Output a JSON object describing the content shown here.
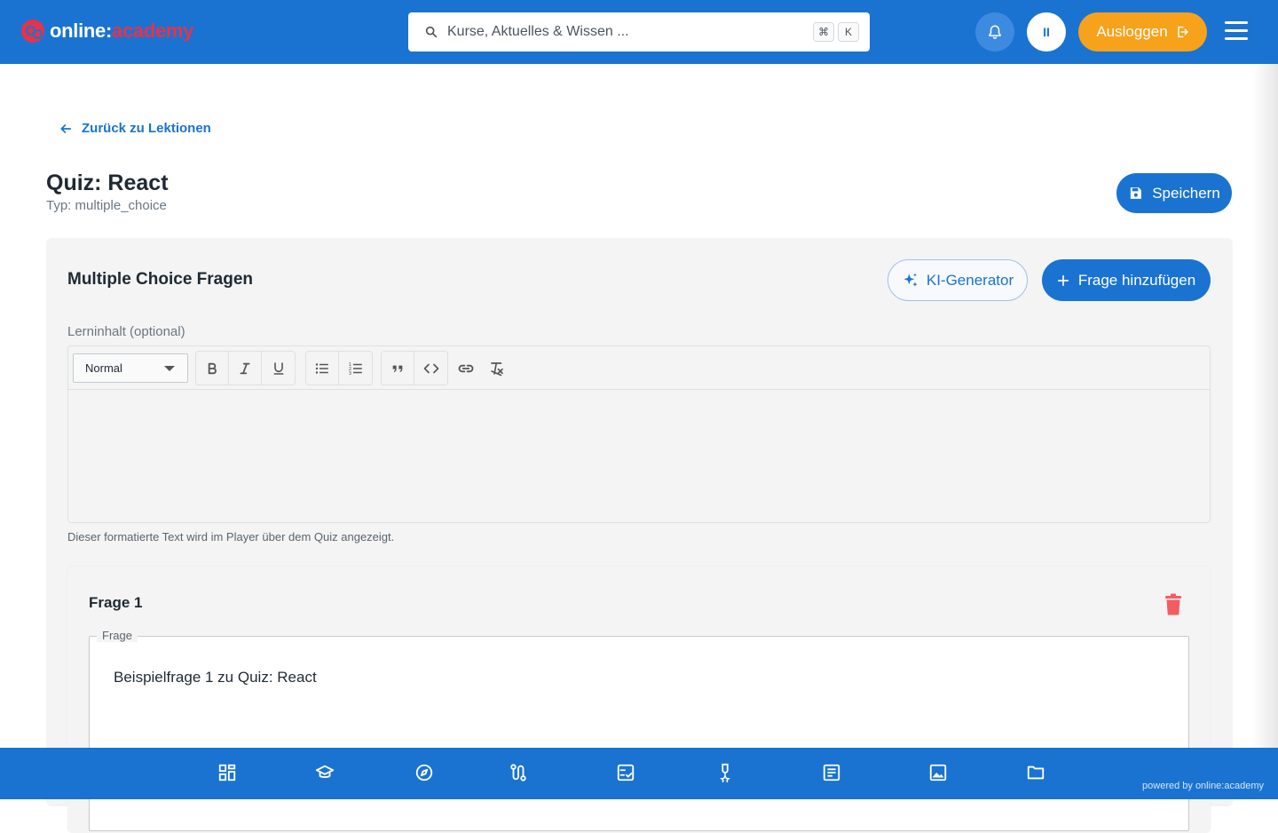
{
  "header": {
    "logo": {
      "part1": "online:",
      "part2": "academy"
    },
    "search": {
      "placeholder": "Kurse, Aktuelles & Wissen ...",
      "kbd_cmd": "⌘",
      "kbd_key": "K"
    },
    "avatar_initials": "II",
    "logout_label": "Ausloggen"
  },
  "page": {
    "back_label": "Zurück zu Lektionen",
    "title": "Quiz: React",
    "subtitle": "Typ: multiple_choice",
    "save_label": "Speichern"
  },
  "panel": {
    "title": "Multiple Choice Fragen",
    "ki_label": "KI-Generator",
    "add_label": "Frage hinzufügen",
    "content_label": "Lerninhalt (optional)",
    "format_select": "Normal",
    "hint": "Dieser formatierte Text wird im Player über dem Quiz angezeigt."
  },
  "question": {
    "title": "Frage 1",
    "legend": "Frage",
    "text": "Beispielfrage 1 zu Quiz: React"
  },
  "footer": {
    "powered": "powered by online:academy",
    "nav_icons": [
      "dashboard-icon",
      "graduation-cap-icon",
      "compass-icon",
      "route-icon",
      "checklist-icon",
      "award-icon",
      "article-icon",
      "image-icon",
      "folder-icon"
    ]
  },
  "colors": {
    "primary": "#1a73d1",
    "accent": "#f7a21b",
    "brand_red": "#e5334b",
    "danger": "#f25c62"
  }
}
